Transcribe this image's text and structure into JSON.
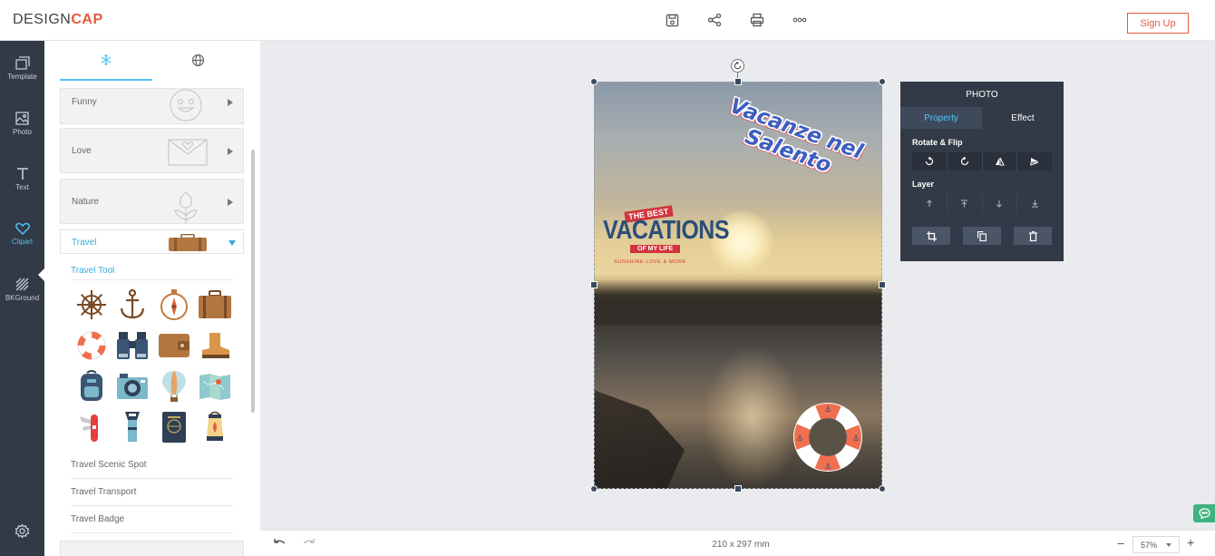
{
  "app": {
    "logo_part1": "DESIGN",
    "logo_part2": "CAP",
    "signup_label": "Sign Up"
  },
  "toolbar": {
    "icons": [
      "save-icon",
      "share-icon",
      "print-icon",
      "more-icon"
    ]
  },
  "leftnav": {
    "items": [
      {
        "label": "Template",
        "icon": "template-icon"
      },
      {
        "label": "Photo",
        "icon": "photo-icon"
      },
      {
        "label": "Text",
        "icon": "text-icon"
      },
      {
        "label": "Clipart",
        "icon": "heart-icon",
        "active": true
      },
      {
        "label": "BKGround",
        "icon": "background-icon"
      }
    ],
    "settings_icon": "gear-icon"
  },
  "panel": {
    "tabs": [
      "snowflake-icon",
      "globe-icon"
    ],
    "categories": [
      {
        "name": "Funny"
      },
      {
        "name": "Love"
      },
      {
        "name": "Nature"
      },
      {
        "name": "Travel",
        "open": true
      }
    ],
    "subcategory_open": "Travel Tool",
    "clipart": [
      "ship-wheel-icon",
      "anchor-icon",
      "compass-icon",
      "suitcase-icon",
      "lifebuoy-icon",
      "binoculars-icon",
      "wallet-icon",
      "boot-icon",
      "backpack-icon",
      "camera-icon",
      "hot-air-balloon-icon",
      "map-icon",
      "swiss-knife-icon",
      "flashlight-icon",
      "passport-icon",
      "lantern-icon"
    ],
    "sublinks": [
      "Travel Scenic Spot",
      "Travel Transport",
      "Travel Badge"
    ]
  },
  "canvas": {
    "text_vacanze": "Vacanze nel Salento",
    "badge": {
      "top": "THE BEST",
      "main": "VACATIONS",
      "ribbon": "OF MY LIFE",
      "sub": "SUNSHINE LOVE & MORE"
    }
  },
  "photo_panel": {
    "title": "PHOTO",
    "tabs": [
      "Property",
      "Effect"
    ],
    "rotate_label": "Rotate & Flip",
    "layer_label": "Layer"
  },
  "bottom": {
    "dimensions": "210 x 297 mm",
    "zoom": "57%",
    "zoom_minus": "−",
    "zoom_plus": "+"
  },
  "colors": {
    "accent": "#4fc3f7",
    "brand": "#e55a3c",
    "nav_bg": "#323a47"
  }
}
